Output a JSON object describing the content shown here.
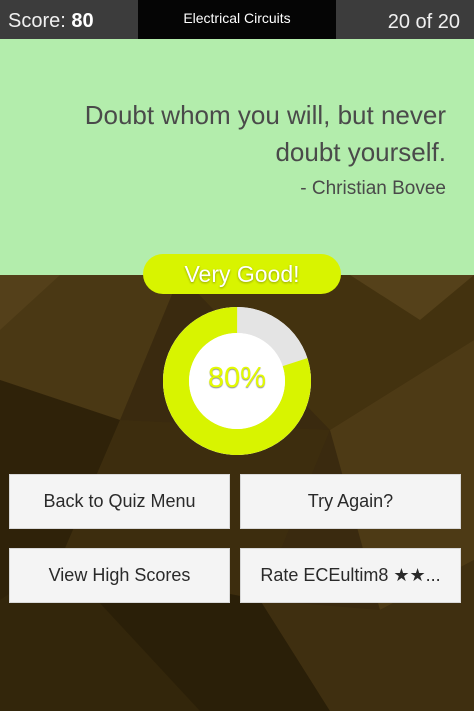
{
  "header": {
    "score_label": "Score:",
    "score_value": "80",
    "quiz_title": "Electrical Circuits",
    "progress": "20 of 20"
  },
  "quote": {
    "text": "Doubt whom you will, but never doubt yourself.",
    "author": "- Christian Bovee"
  },
  "result": {
    "rating": "Very Good!",
    "percent_label": "80%",
    "percent_value": 80
  },
  "buttons": {
    "back_to_menu": "Back to Quiz Menu",
    "try_again": "Try Again?",
    "view_high_scores": "View High Scores",
    "rate_app": "Rate ECEultim8 ★★..."
  },
  "colors": {
    "accent": "#d8f400",
    "quote_panel": "#b3edac",
    "header": "#3c3c3c",
    "background": "#3a2a0f",
    "donut_track": "#e4e4e4"
  }
}
